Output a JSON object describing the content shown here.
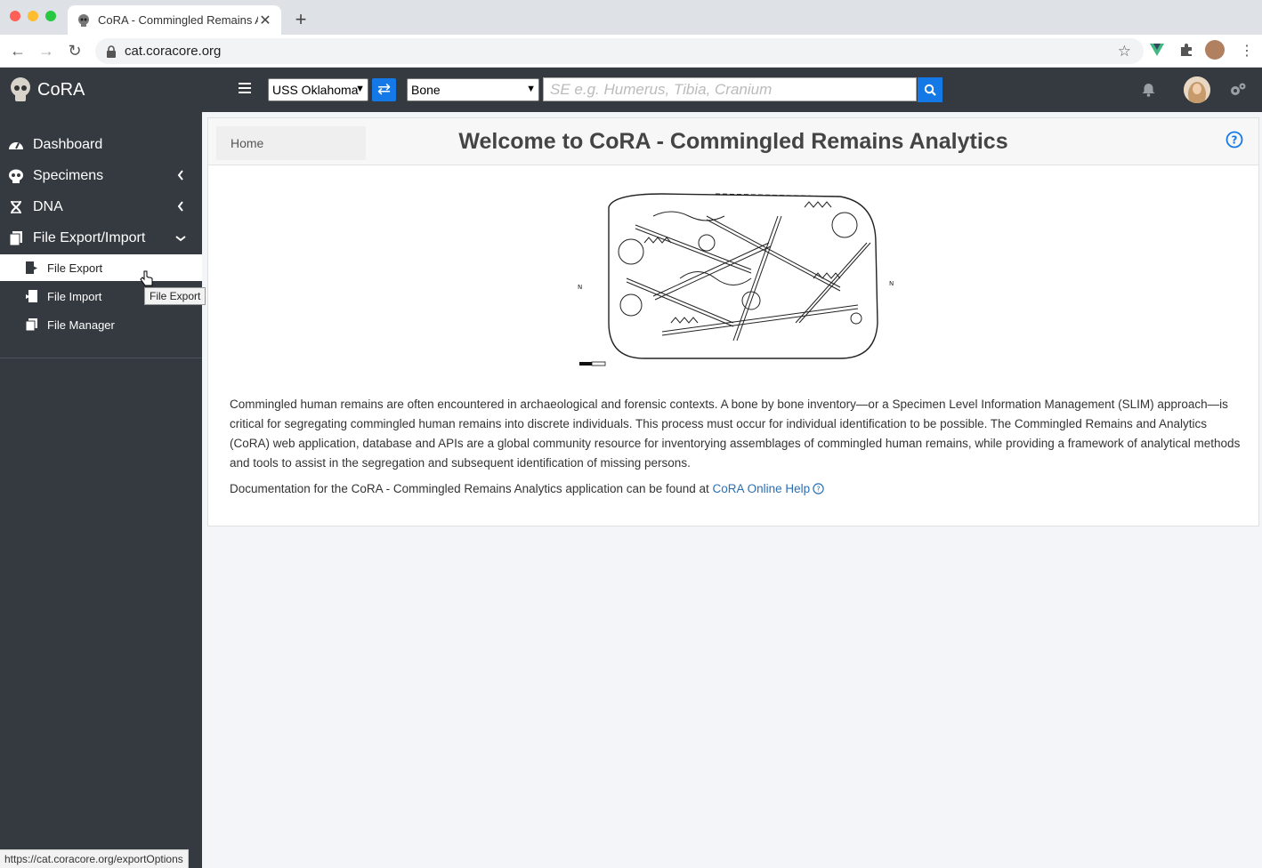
{
  "browser": {
    "tab_title": "CoRA - Commingled Remains A",
    "url": "cat.coracore.org",
    "status_url": "https://cat.coracore.org/exportOptions"
  },
  "header": {
    "brand": "CoRA",
    "project_select": "USS Oklahoma",
    "type_select": "Bone",
    "search_placeholder": "SE e.g. Humerus, Tibia, Cranium",
    "accent_color": "#1479e6"
  },
  "sidebar": {
    "items": [
      {
        "label": "Dashboard",
        "icon": "gauge-icon"
      },
      {
        "label": "Specimens",
        "icon": "skull-icon"
      },
      {
        "label": "DNA",
        "icon": "dna-icon"
      },
      {
        "label": "File Export/Import",
        "icon": "files-icon"
      }
    ],
    "subitems": [
      {
        "label": "File Export",
        "icon": "file-export-icon"
      },
      {
        "label": "File Import",
        "icon": "file-import-icon"
      },
      {
        "label": "File Manager",
        "icon": "file-manager-icon"
      }
    ],
    "tooltip": "File Export"
  },
  "main": {
    "breadcrumb": "Home",
    "title": "Welcome to CoRA - Commingled Remains Analytics",
    "intro": "Commingled human remains are often encountered in archaeological and forensic contexts. A bone by bone inventory—or a Specimen Level Information Management (SLIM) approach—is critical for segregating commingled human remains into discrete individuals. This process must occur for individual identification to be possible. The Commingled Remains and Analytics (CoRA) web application, database and APIs are a global community resource for inventorying assemblages of commingled human remains, while providing a framework of analytical methods and tools to assist in the segregation and subsequent identification of missing persons.",
    "doc_prefix": "Documentation for the CoRA - Commingled Remains Analytics application can be found at ",
    "doc_link": "CoRA Online Help"
  }
}
